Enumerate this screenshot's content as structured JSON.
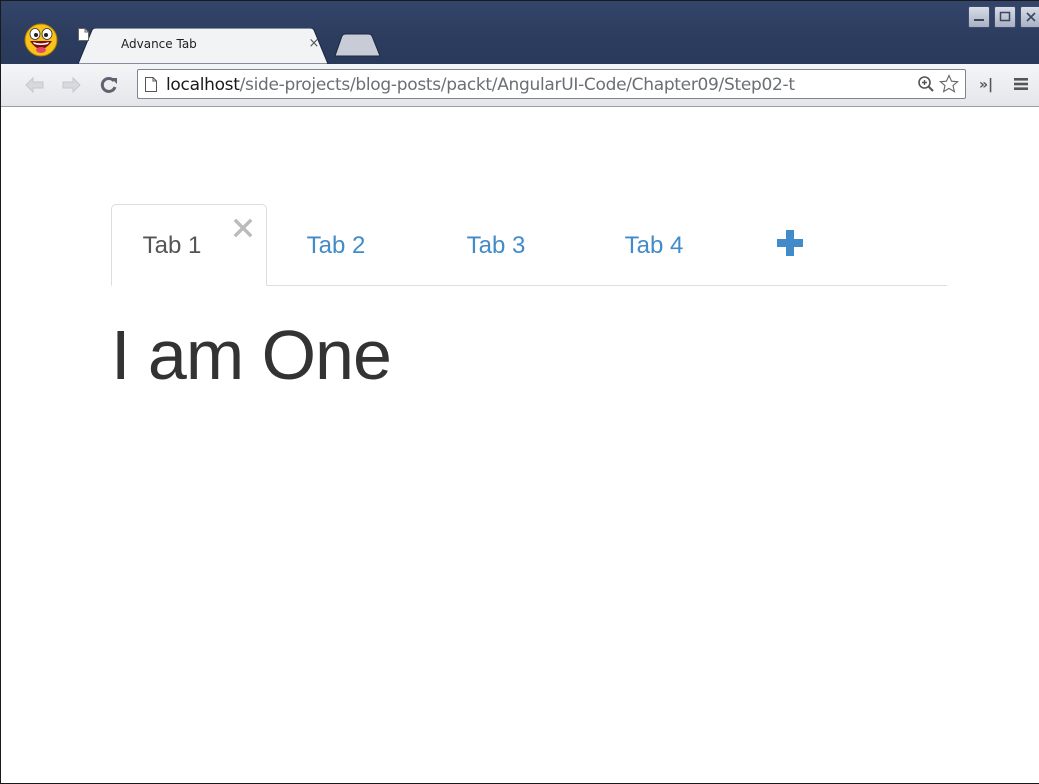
{
  "browser": {
    "tab_title": "Advance Tab",
    "tab_close_glyph": "×",
    "url_host": "localhost",
    "url_path": "/side-projects/blog-posts/packt/AngularUI-Code/Chapter09/Step02-t",
    "overflow_glyph": "»|",
    "icons": [
      "smiley-avatar-icon",
      "page-icon",
      "close-icon",
      "new-tab-icon",
      "minimize-icon",
      "maximize-icon",
      "window-close-icon",
      "back-icon",
      "forward-icon",
      "reload-icon",
      "zoom-icon",
      "star-icon",
      "menu-icon"
    ]
  },
  "page": {
    "tabs": [
      {
        "label": "Tab 1",
        "active": true
      },
      {
        "label": "Tab 2",
        "active": false
      },
      {
        "label": "Tab 3",
        "active": false
      },
      {
        "label": "Tab 4",
        "active": false
      }
    ],
    "content_heading": "I am One",
    "colors": {
      "link": "#428bca",
      "active_text": "#555555",
      "heading": "#333333",
      "remove_icon": "#bbbbbb"
    }
  }
}
